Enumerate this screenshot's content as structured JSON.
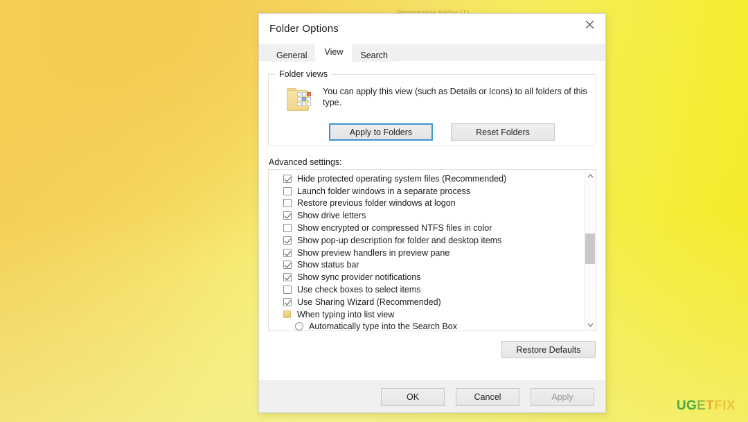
{
  "page": {
    "background_top_left": "#f4cf5c",
    "background_top_right": "#f5e92b",
    "background_bottom_left": "#f2ef90",
    "ghost_text": "Personalize folder (1)"
  },
  "dialog": {
    "title": "Folder Options",
    "close_icon": "close-icon",
    "tabs": [
      {
        "label": "General",
        "active": false
      },
      {
        "label": "View",
        "active": true
      },
      {
        "label": "Search",
        "active": false
      }
    ],
    "folder_views": {
      "legend": "Folder views",
      "icon": "folder-with-icons-icon",
      "description": "You can apply this view (such as Details or Icons) to all folders of this type.",
      "apply_button": "Apply to Folders",
      "reset_button": "Reset Folders"
    },
    "advanced": {
      "label": "Advanced settings:",
      "items": [
        {
          "type": "checkbox",
          "checked": true,
          "label": "Hide protected operating system files (Recommended)"
        },
        {
          "type": "checkbox",
          "checked": false,
          "label": "Launch folder windows in a separate process"
        },
        {
          "type": "checkbox",
          "checked": false,
          "label": "Restore previous folder windows at logon"
        },
        {
          "type": "checkbox",
          "checked": true,
          "label": "Show drive letters"
        },
        {
          "type": "checkbox",
          "checked": false,
          "label": "Show encrypted or compressed NTFS files in color"
        },
        {
          "type": "checkbox",
          "checked": true,
          "label": "Show pop-up description for folder and desktop items"
        },
        {
          "type": "checkbox",
          "checked": true,
          "label": "Show preview handlers in preview pane"
        },
        {
          "type": "checkbox",
          "checked": true,
          "label": "Show status bar"
        },
        {
          "type": "checkbox",
          "checked": true,
          "label": "Show sync provider notifications"
        },
        {
          "type": "checkbox",
          "checked": false,
          "label": "Use check boxes to select items"
        },
        {
          "type": "checkbox",
          "checked": true,
          "label": "Use Sharing Wizard (Recommended)"
        },
        {
          "type": "group",
          "checked": false,
          "label": "When typing into list view"
        },
        {
          "type": "radio",
          "checked": false,
          "label": "Automatically type into the Search Box"
        }
      ],
      "scrollbar": {
        "up_icon": "chevron-up-icon",
        "down_icon": "chevron-down-icon",
        "thumb_top_percent": 38,
        "thumb_height_percent": 22
      }
    },
    "restore_defaults_button": "Restore Defaults",
    "footer": {
      "ok": "OK",
      "cancel": "Cancel",
      "apply": "Apply",
      "apply_disabled": true
    }
  },
  "watermark": {
    "part1": "UG",
    "part2": "E",
    "part3": "T",
    "part4": "FIX",
    "full": "UGETFIX"
  }
}
